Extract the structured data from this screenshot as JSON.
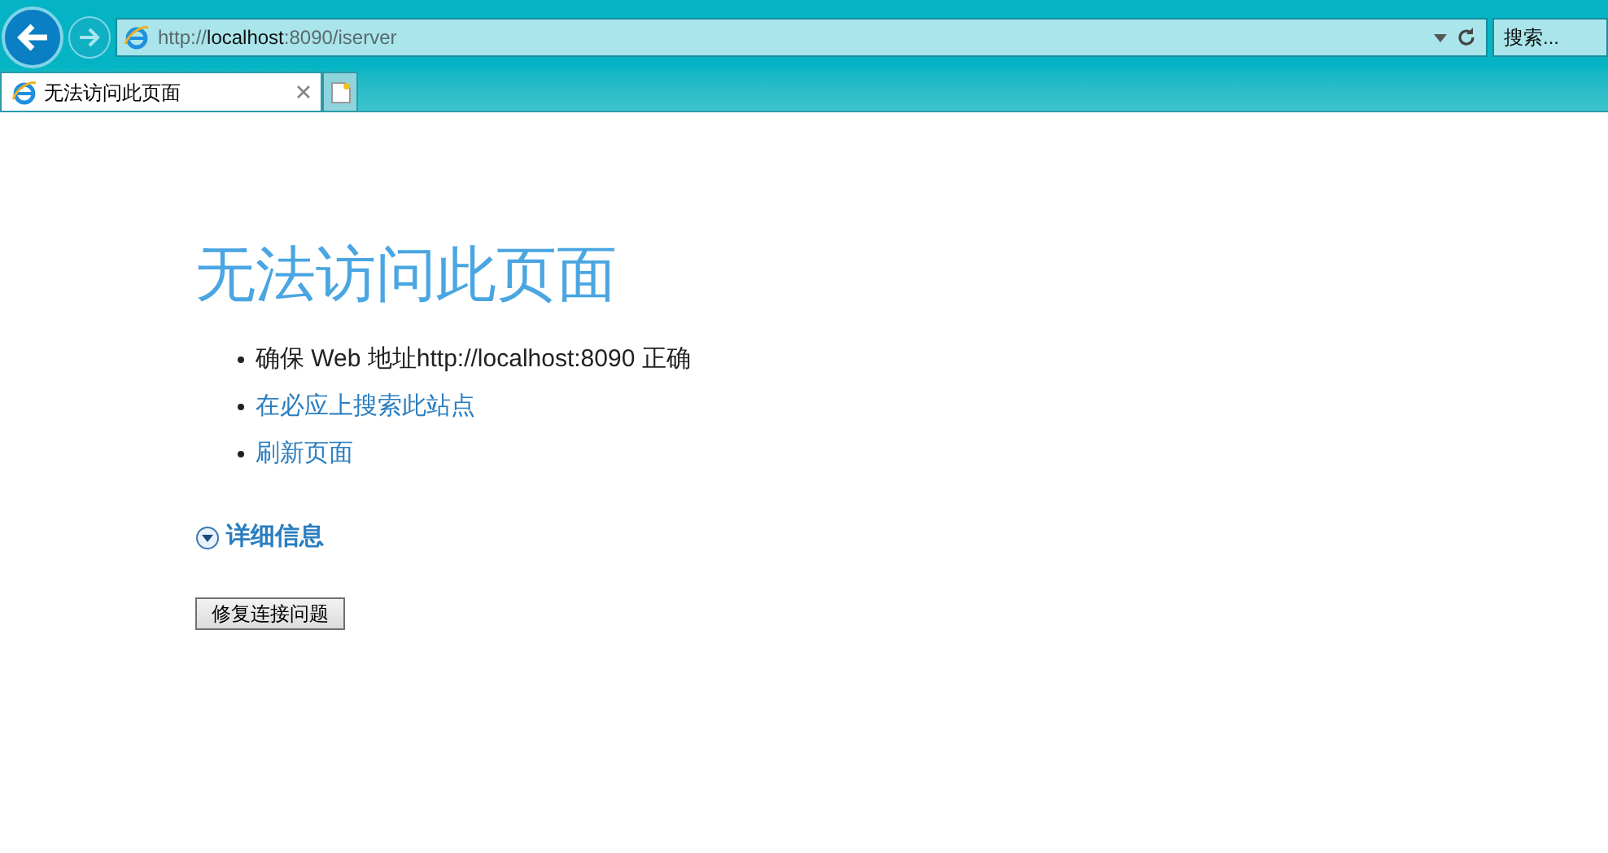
{
  "address_bar": {
    "url_prefix": "http://",
    "url_host": "localhost",
    "url_suffix": ":8090/iserver"
  },
  "search_box": {
    "placeholder": "搜索..."
  },
  "tabs": [
    {
      "label": "无法访问此页面",
      "selected": true
    }
  ],
  "page": {
    "title": "无法访问此页面",
    "items": [
      {
        "kind": "text",
        "text": "确保 Web 地址http://localhost:8090 正确"
      },
      {
        "kind": "link",
        "text": "在必应上搜索此站点"
      },
      {
        "kind": "link",
        "text": "刷新页面"
      }
    ],
    "details": {
      "label": "详细信息",
      "expanded": false
    },
    "button": "修复连接问题"
  }
}
